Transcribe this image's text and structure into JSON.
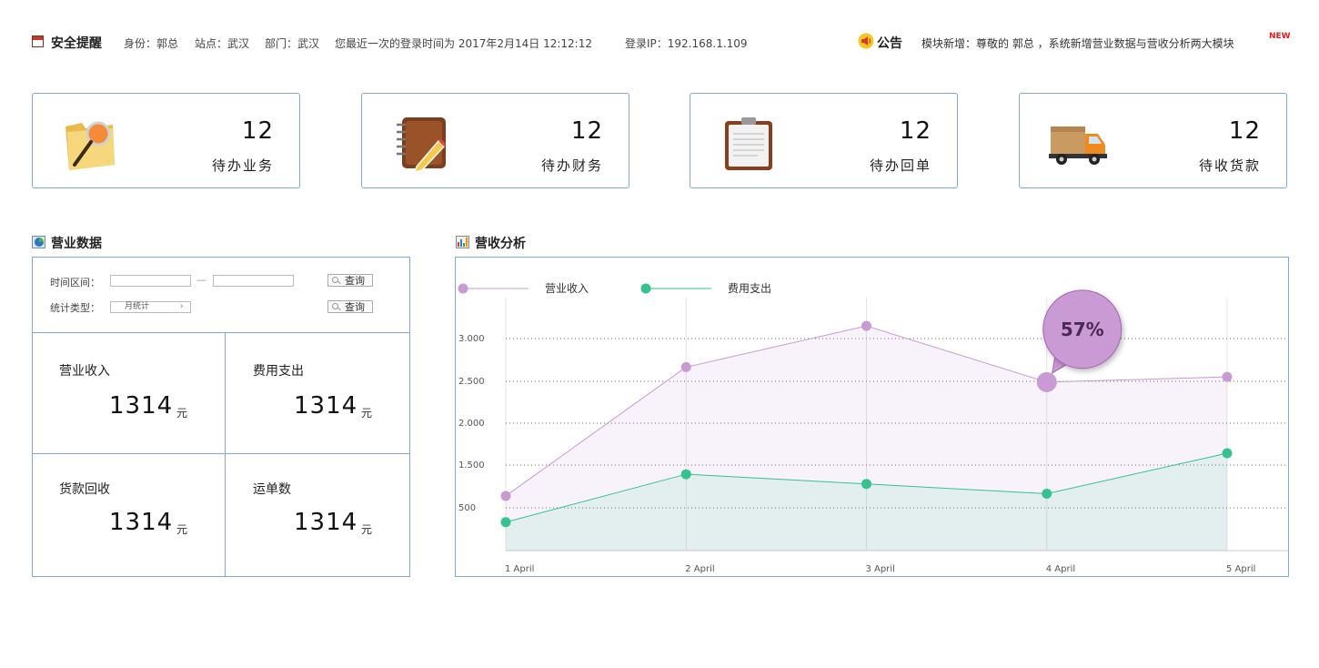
{
  "header": {
    "security_title": "安全提醒",
    "identity": "身份：郭总",
    "site": "站点：武汉",
    "department": "部门：武汉",
    "last_login": "您最近一次的登录时间为 2017年2月14日   12:12:12",
    "login_ip": "登录IP：192.168.1.109",
    "notice_title": "公告",
    "notice_text": "模块新增：尊敬的 郭总 ，系统新增营业数据与营收分析两大模块",
    "new_badge": "NEW"
  },
  "cards": [
    {
      "value": "12",
      "label": "待办业务",
      "icon": "folder-search-icon"
    },
    {
      "value": "12",
      "label": "待办财务",
      "icon": "notebook-pencil-icon"
    },
    {
      "value": "12",
      "label": "待办回单",
      "icon": "clipboard-icon"
    },
    {
      "value": "12",
      "label": "待收货款",
      "icon": "delivery-truck-icon"
    }
  ],
  "business": {
    "title": "营业数据",
    "filters": {
      "range_label": "时间区间：",
      "range_sep": "—",
      "type_label": "统计类型：",
      "type_value": "月统计",
      "query_label": "查询"
    },
    "metrics": [
      {
        "label": "营业收入",
        "value": "1314",
        "unit": "元"
      },
      {
        "label": "费用支出",
        "value": "1314",
        "unit": "元"
      },
      {
        "label": "货款回收",
        "value": "1314",
        "unit": "元"
      },
      {
        "label": "运单数",
        "value": "1314",
        "unit": "元"
      }
    ]
  },
  "analysis": {
    "title": "营收分析",
    "bubble": "57%"
  },
  "chart_data": {
    "type": "area",
    "x": [
      "1 April",
      "2 April",
      "3 April",
      "4 April",
      "5 April"
    ],
    "yticks": [
      "500",
      "1.500",
      "2.000",
      "2.500",
      "3.000"
    ],
    "ylim": [
      0,
      3500
    ],
    "grid": true,
    "legend_position": "top-left",
    "series": [
      {
        "name": "营业收入",
        "color": "#c99ad3",
        "values": [
          730,
          2450,
          3000,
          2250,
          2320
        ]
      },
      {
        "name": "费用支出",
        "color": "#35c28f",
        "values": [
          380,
          1020,
          890,
          760,
          1300
        ]
      }
    ],
    "highlight": {
      "series": 0,
      "index": 3,
      "label": "57%"
    }
  }
}
